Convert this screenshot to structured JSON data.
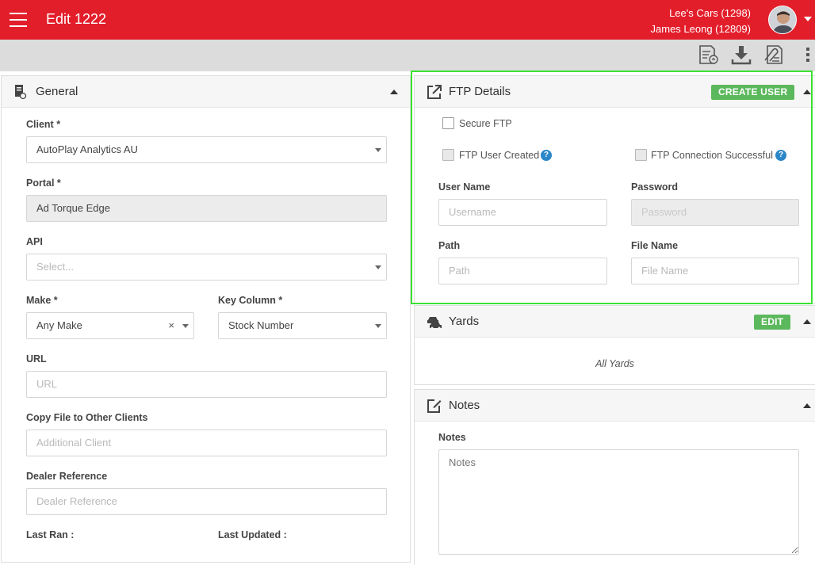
{
  "header": {
    "title": "Edit 1222",
    "dealer": "Lee's Cars (1298)",
    "user": "James Leong (12809)"
  },
  "toolbar": {
    "icons": [
      "report-icon",
      "download-icon",
      "attachments-icon",
      "more-icon"
    ]
  },
  "general": {
    "title": "General",
    "client_label": "Client *",
    "client_value": "AutoPlay Analytics AU",
    "portal_label": "Portal *",
    "portal_value": "Ad Torque Edge",
    "api_label": "API",
    "api_placeholder": "Select...",
    "make_label": "Make *",
    "make_value": "Any Make",
    "key_column_label": "Key Column *",
    "key_column_value": "Stock Number",
    "url_label": "URL",
    "url_placeholder": "URL",
    "copy_label": "Copy File to Other Clients",
    "copy_placeholder": "Additional Client",
    "dealer_ref_label": "Dealer Reference",
    "dealer_ref_placeholder": "Dealer Reference",
    "last_ran_label": "Last Ran :",
    "last_updated_label": "Last Updated :"
  },
  "ftp": {
    "title": "FTP Details",
    "create_user_label": "CREATE USER",
    "secure_ftp_label": "Secure FTP",
    "user_created_label": "FTP User Created",
    "connection_label": "FTP Connection Successful",
    "help_glyph": "?",
    "username_label": "User Name",
    "username_placeholder": "Username",
    "password_label": "Password",
    "password_placeholder": "Password",
    "path_label": "Path",
    "path_placeholder": "Path",
    "filename_label": "File Name",
    "filename_placeholder": "File Name"
  },
  "yards": {
    "title": "Yards",
    "edit_label": "EDIT",
    "all_yards": "All Yards"
  },
  "notes": {
    "title": "Notes",
    "notes_label": "Notes",
    "notes_placeholder": "Notes"
  },
  "colors": {
    "header_red": "#e31e2b",
    "button_green": "#5cb85c",
    "highlight_green": "#3ce133",
    "help_blue": "#2a87c8"
  }
}
